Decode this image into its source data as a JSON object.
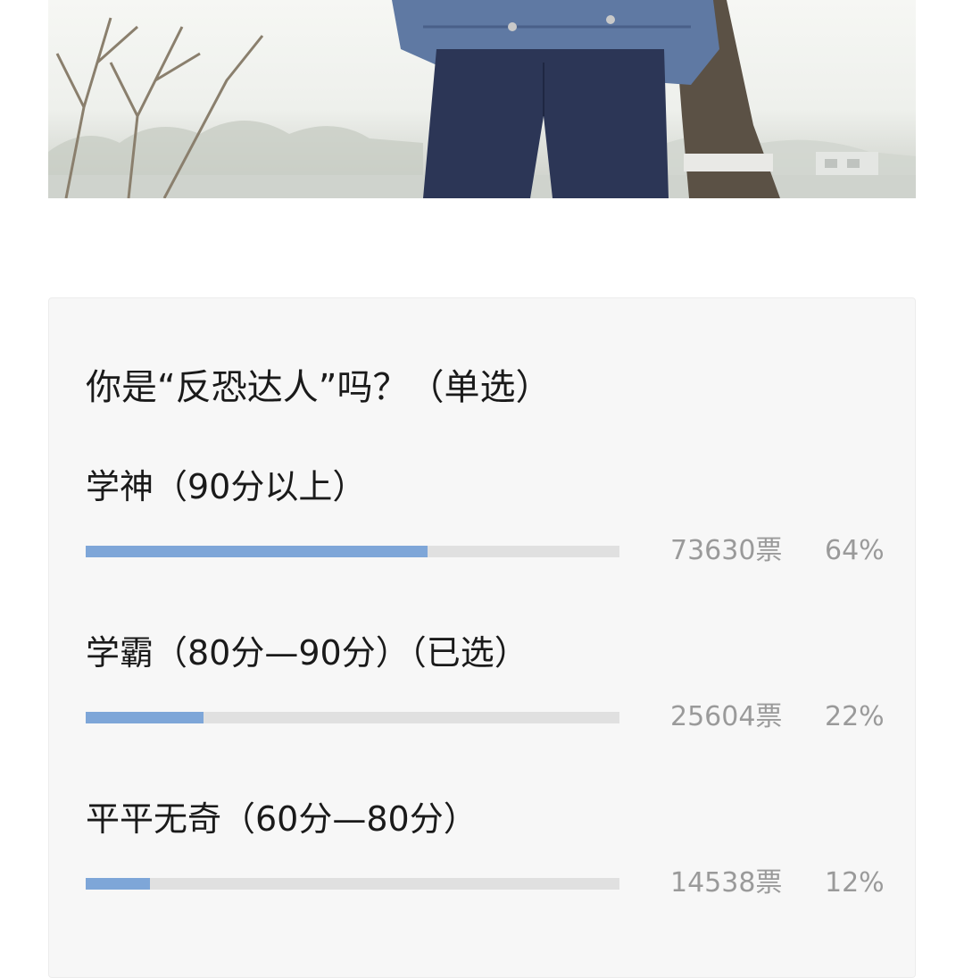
{
  "photo": {
    "description_icon": "photo-person-denim-jacket-by-tree"
  },
  "poll": {
    "question": "你是“反恐达人”吗？（单选）",
    "bar_color": "#7ea6d8",
    "track_color": "#e0e0e0",
    "options": [
      {
        "label": "学神（90分以上）",
        "votes": "73630票",
        "percent": "64%",
        "fill": 0.64
      },
      {
        "label": "学霸（80分—90分）（已选）",
        "votes": "25604票",
        "percent": "22%",
        "fill": 0.22
      },
      {
        "label": "平平无奇（60分—80分）",
        "votes": "14538票",
        "percent": "12%",
        "fill": 0.12
      }
    ]
  }
}
